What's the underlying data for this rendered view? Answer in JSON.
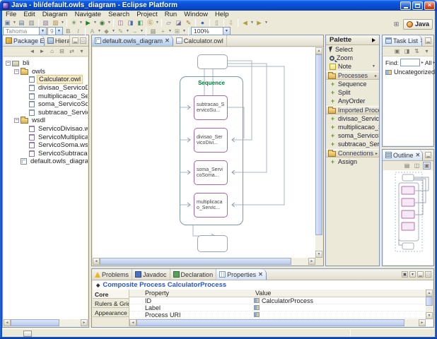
{
  "window": {
    "title": "Java - bli/default.owls_diagram - Eclipse Platform"
  },
  "menu": {
    "items": [
      "File",
      "Edit",
      "Diagram",
      "Navigate",
      "Search",
      "Project",
      "Run",
      "Window",
      "Help"
    ]
  },
  "toolbar": {
    "row1": [
      {
        "name": "new-wizard",
        "glyph": "▣"
      },
      {
        "name": "save",
        "glyph": "▤"
      },
      {
        "name": "print",
        "glyph": "▥"
      },
      {
        "name": "new-owl-project",
        "glyph": "▧"
      },
      {
        "name": "new-folder",
        "glyph": "▨"
      },
      {
        "name": "debug",
        "glyph": "✳"
      },
      {
        "name": "run",
        "glyph": "▶"
      },
      {
        "name": "external-tools",
        "glyph": "◉"
      },
      {
        "name": "owl-wizard",
        "glyph": "◫"
      },
      {
        "name": "owls-wizard",
        "glyph": "◨"
      },
      {
        "name": "ontology-wizard",
        "glyph": "◧"
      },
      {
        "name": "generate",
        "glyph": "Ⓖ"
      },
      {
        "name": "open-type",
        "glyph": "▱"
      },
      {
        "name": "import",
        "glyph": "◪"
      },
      {
        "name": "annotate",
        "glyph": "✎"
      },
      {
        "name": "web-browser",
        "glyph": "●"
      },
      {
        "name": "document",
        "glyph": "▯"
      },
      {
        "name": "last-edit-location",
        "glyph": "⇩"
      },
      {
        "name": "back",
        "glyph": "◀"
      },
      {
        "name": "forward",
        "glyph": "▶"
      }
    ],
    "row2": {
      "font": "Tahoma",
      "size": "9",
      "bold": "B",
      "italic": "I",
      "icons": [
        {
          "name": "font-color",
          "glyph": "A"
        },
        {
          "name": "fill-color",
          "glyph": "◆"
        },
        {
          "name": "line-color",
          "glyph": "✎"
        },
        {
          "name": "arrow-style",
          "glyph": "→"
        },
        {
          "name": "select-all",
          "glyph": "▦"
        },
        {
          "name": "zoom-tool",
          "glyph": "+"
        },
        {
          "name": "grid",
          "glyph": "⊞"
        }
      ],
      "zoom": "100%"
    },
    "perspective": {
      "label": "Java"
    }
  },
  "package_explorer": {
    "tab": "Package Explor...",
    "tab_hierarchy": "Hierarchy",
    "items": [
      {
        "label": "bli"
      },
      {
        "label": "owls"
      },
      {
        "label": "Calculator.owl"
      },
      {
        "label": "divisao_ServicoDivisao.owl"
      },
      {
        "label": "multiplicacao_ServicoMultiplicacao.owl"
      },
      {
        "label": "soma_ServicoSoma.owl"
      },
      {
        "label": "subtracao_ServicoSubtracao.owl"
      },
      {
        "label": "wsdl"
      },
      {
        "label": "ServicoDivisao.wsdl"
      },
      {
        "label": "ServicoMultiplicacao.wsdl"
      },
      {
        "label": "ServicoSoma.wsdl"
      },
      {
        "label": "ServicoSubtracao.wsdl"
      },
      {
        "label": "default.owls_diagram"
      }
    ]
  },
  "editor": {
    "tab_active": "default.owls_diagram",
    "tab_inactive": "Calculator.owl",
    "diagram": {
      "sequence_label": "Sequence",
      "nodes": [
        "subtracao_ServicoSu...",
        "divisao_ServicoDivi...",
        "soma_ServicoSoma...",
        "multiplicacao_Servic..."
      ]
    }
  },
  "palette": {
    "title": "Palette",
    "tools": [
      "Select",
      "Zoom",
      "Note"
    ],
    "groups": [
      {
        "label": "Processes",
        "items": [
          "Sequence",
          "Split",
          "AnyOrder"
        ]
      },
      {
        "label": "Imported Process",
        "items": [
          "divisao_ServicoD...",
          "multiplicacao_Ser...",
          "soma_ServicoSo...",
          "subtracao_Servi..."
        ]
      },
      {
        "label": "Connections",
        "items": [
          "Assign"
        ]
      }
    ]
  },
  "task_list": {
    "tab": "Task List",
    "find_label": "Find:",
    "all_label": "All",
    "item": "Uncategorized"
  },
  "outline": {
    "tab": "Outline"
  },
  "properties": {
    "tabs": [
      "Problems",
      "Javadoc",
      "Declaration",
      "Properties"
    ],
    "title": "Composite Process CalculatorProcess",
    "side_tabs": [
      "Core",
      "Rulers & Grid",
      "Appearance"
    ],
    "columns": [
      "Property",
      "Value"
    ],
    "rows": [
      {
        "property": "ID",
        "value": "CalculatorProcess"
      },
      {
        "property": "Label",
        "value": ""
      },
      {
        "property": "Process URI",
        "value": ""
      }
    ]
  },
  "colors": {
    "titlebar": "#0a50d8",
    "selection": "#f5ecd0",
    "sequence_green": "#007a3c",
    "node_border": "#a966a9",
    "header_blue": "#2a56c6"
  }
}
